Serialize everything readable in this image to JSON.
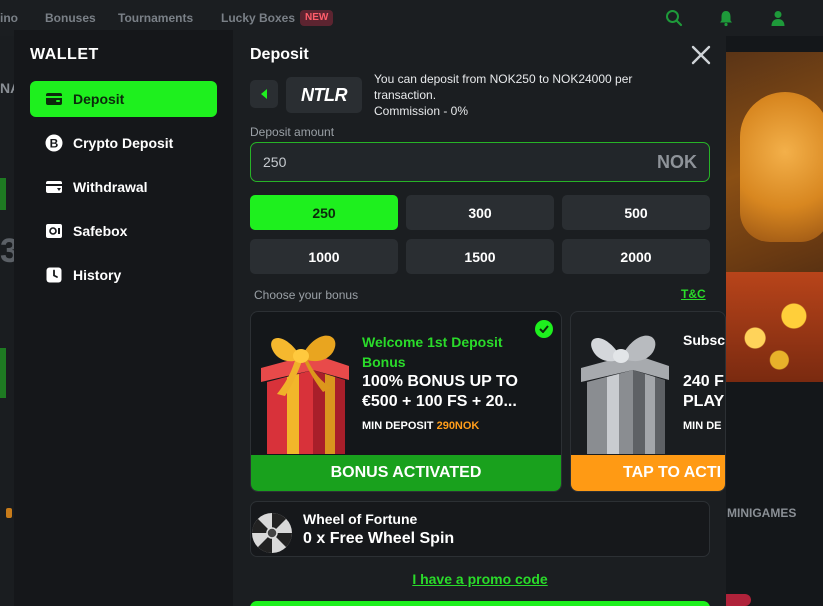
{
  "topnav": {
    "items": [
      "ino",
      "Bonuses",
      "Tournaments",
      "Lucky Boxes"
    ],
    "new_badge": "NEW",
    "icons": [
      "search-icon",
      "bell-icon",
      "user-icon"
    ]
  },
  "background": {
    "side_text": "NA",
    "side_number": "3",
    "minigames_label": "MINIGAMES"
  },
  "wallet": {
    "title": "WALLET",
    "menu": [
      {
        "label": "Deposit",
        "icon": "wallet-icon",
        "active": true
      },
      {
        "label": "Crypto Deposit",
        "icon": "bitcoin-icon",
        "active": false
      },
      {
        "label": "Withdrawal",
        "icon": "withdraw-icon",
        "active": false
      },
      {
        "label": "Safebox",
        "icon": "safe-icon",
        "active": false
      },
      {
        "label": "History",
        "icon": "clock-icon",
        "active": false
      }
    ]
  },
  "deposit": {
    "title": "Deposit",
    "method": "NTLR",
    "info_line1": "You can deposit from NOK250 to NOK24000 per",
    "info_line2": "transaction.",
    "info_line3": "Commission - 0%",
    "amount_label": "Deposit amount",
    "amount_value": "250",
    "currency": "NOK",
    "quick_amounts": [
      "250",
      "300",
      "500",
      "1000",
      "1500",
      "2000"
    ],
    "selected_amount": "250",
    "bonus_label": "Choose your bonus",
    "tnc_label": "T&C",
    "promo_link": "I have a promo code"
  },
  "bonuses": [
    {
      "subtitle": "Welcome 1st Deposit Bonus",
      "headline": "100% BONUS UP TO €500 + 100 FS + 20...",
      "min_label": "MIN DEPOSIT",
      "min_value": "290NOK",
      "footer": "BONUS ACTIVATED",
      "selected": true
    },
    {
      "subtitle": "Subsc",
      "headline_line1": "240 F",
      "headline_line2": "PLAY",
      "min_label": "MIN DE",
      "footer": "TAP TO ACTI",
      "selected": false
    }
  ],
  "wheel": {
    "title": "Wheel of Fortune",
    "subtitle": "0 x Free Wheel Spin"
  },
  "colors": {
    "accent_green": "#1ef01e",
    "activated_green": "#19a11d",
    "orange": "#ff9a14",
    "panel": "#1b1e21"
  }
}
